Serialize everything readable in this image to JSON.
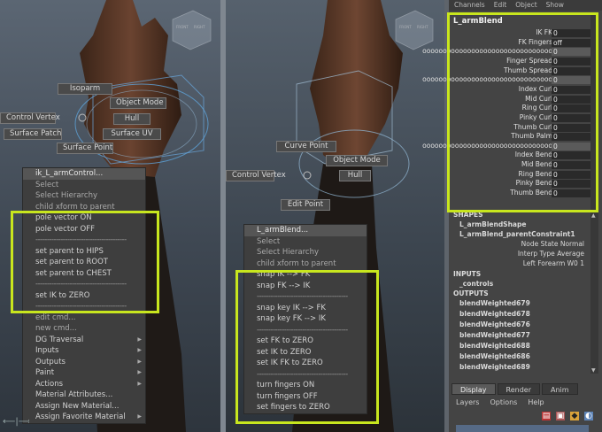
{
  "left_viewport": {
    "view_cube": [
      "FRONT",
      "RIGHT"
    ],
    "marking_menu": [
      "Isoparm",
      "Object Mode",
      "Hull",
      "Control Vertex",
      "Surface Patch",
      "Surface UV",
      "Surface Point"
    ],
    "menu_title": "ik_L_armControl...",
    "items": [
      "Select",
      "Select Hierarchy",
      "child xform to parent"
    ],
    "custom_items": [
      "pole vector ON",
      "pole vector OFF",
      "----------------------------------------",
      "set parent to HIPS",
      "set parent to ROOT",
      "set parent to CHEST",
      "----------------------------------------",
      "set IK to ZERO"
    ],
    "bottom_items": [
      "----------------------------------------",
      "edit cmd...",
      "new cmd...",
      "DG Traversal",
      "Inputs",
      "Outputs",
      "Paint",
      "Actions",
      "Material Attributes...",
      "Assign New Material...",
      "Assign Favorite Material"
    ]
  },
  "right_viewport": {
    "view_cube": [
      "FRONT",
      "RIGHT"
    ],
    "marking_menu": [
      "Curve Point",
      "Object Mode",
      "Control Vertex",
      "Hull",
      "Edit Point"
    ],
    "menu_title": "L_armBlend...",
    "items": [
      "Select",
      "Select Hierarchy",
      "child xform to parent"
    ],
    "custom_items": [
      "snap IK --> FK",
      "snap FK --> IK",
      "----------------------------------------",
      "snap  key IK --> FK",
      "snap  key FK --> IK",
      "----------------------------------------",
      "set FK to ZERO",
      "set IK to ZERO",
      "set IK  FK to ZERO",
      "----------------------------------------",
      "turn fingers ON",
      "turn fingers OFF",
      "set fingers to ZERO"
    ]
  },
  "panel": {
    "menubar": [
      "Channels",
      "Edit",
      "Object",
      "Show"
    ],
    "object_name": "L_armBlend",
    "channels": [
      {
        "label": "IK FK",
        "value": "0"
      },
      {
        "label": "FK Fingers",
        "value": "off"
      },
      {
        "label": "oooooooooooooooooooooooooooooooo",
        "value": "0"
      },
      {
        "label": "Finger Spread",
        "value": "0"
      },
      {
        "label": "Thumb Spread",
        "value": "0"
      },
      {
        "label": "oooooooooooooooooooooooooooooooo",
        "value": "0"
      },
      {
        "label": "Index Curl",
        "value": "0"
      },
      {
        "label": "Mid Curl",
        "value": "0"
      },
      {
        "label": "Ring Curl",
        "value": "0"
      },
      {
        "label": "Pinky Curl",
        "value": "0"
      },
      {
        "label": "Thumb Curl",
        "value": "0"
      },
      {
        "label": "Thumb Palm",
        "value": "0"
      },
      {
        "label": "oooooooooooooooooooooooooooooooo",
        "value": "0"
      },
      {
        "label": "Index Bend",
        "value": "0"
      },
      {
        "label": "Mid Bend",
        "value": "0"
      },
      {
        "label": "Ring Bend",
        "value": "0"
      },
      {
        "label": "Pinky Bend",
        "value": "0"
      },
      {
        "label": "Thumb Bend",
        "value": "0"
      }
    ],
    "shapes_header": "SHAPES",
    "shapes": [
      "L_armBlendShape",
      "L_armBlend_parentConstraint1"
    ],
    "constraint_attrs": [
      {
        "label": "Node State",
        "value": "Normal"
      },
      {
        "label": "Interp Type",
        "value": "Average"
      },
      {
        "label": "Left Forearm W0",
        "value": "1"
      }
    ],
    "inputs_header": "INPUTS",
    "inputs": [
      "_controls"
    ],
    "outputs_header": "OUTPUTS",
    "outputs": [
      "blendWeighted679",
      "blendWeighted678",
      "blendWeighted676",
      "blendWeighted677",
      "blendWeighted688",
      "blendWeighted686",
      "blendWeighted689"
    ],
    "tabs": [
      "Display",
      "Render",
      "Anim"
    ],
    "layer_menu": [
      "Layers",
      "Options",
      "Help"
    ]
  },
  "colors": {
    "highlight": "#c8e61e",
    "menu_bg": "#3e3e3e",
    "panel_bg": "#444444"
  }
}
